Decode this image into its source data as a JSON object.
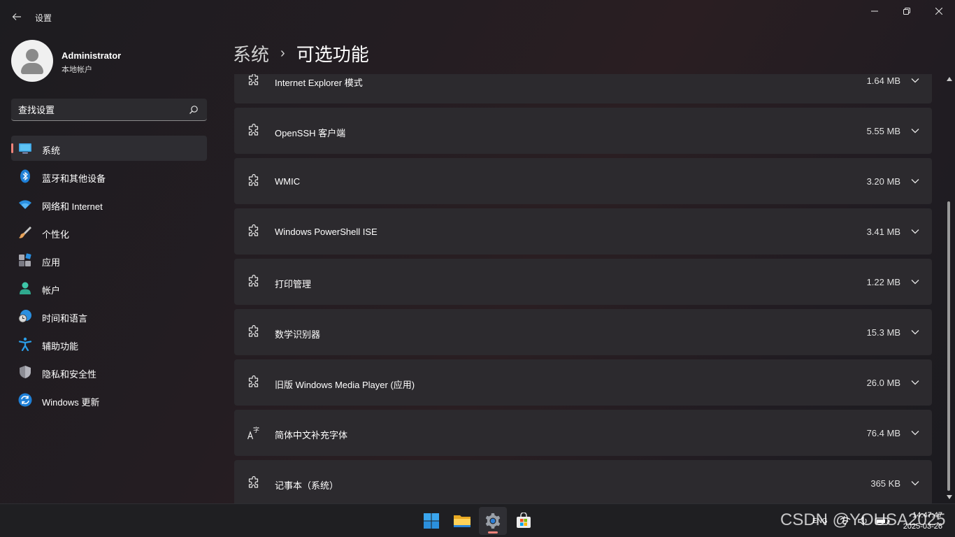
{
  "window": {
    "app_title": "设置",
    "back_icon": "back-arrow-icon",
    "minimize_icon": "minimize-icon",
    "maximize_icon": "restore-icon",
    "close_icon": "close-icon"
  },
  "profile": {
    "name": "Administrator",
    "account_type": "本地帐户"
  },
  "search": {
    "placeholder": "查找设置",
    "icon": "search-icon"
  },
  "sidebar": {
    "items": [
      {
        "label": "系统",
        "icon": "display-icon",
        "active": true
      },
      {
        "label": "蓝牙和其他设备",
        "icon": "bluetooth-icon",
        "active": false
      },
      {
        "label": "网络和 Internet",
        "icon": "wifi-icon",
        "active": false
      },
      {
        "label": "个性化",
        "icon": "paintbrush-icon",
        "active": false
      },
      {
        "label": "应用",
        "icon": "apps-icon",
        "active": false
      },
      {
        "label": "帐户",
        "icon": "person-icon",
        "active": false
      },
      {
        "label": "时间和语言",
        "icon": "globe-clock-icon",
        "active": false
      },
      {
        "label": "辅助功能",
        "icon": "accessibility-icon",
        "active": false
      },
      {
        "label": "隐私和安全性",
        "icon": "shield-icon",
        "active": false
      },
      {
        "label": "Windows 更新",
        "icon": "update-icon",
        "active": false
      }
    ]
  },
  "breadcrumb": {
    "parent": "系统",
    "separator": "›",
    "current": "可选功能"
  },
  "features": [
    {
      "name": "Internet Explorer 模式",
      "size": "1.64 MB",
      "icon": "puzzle-icon"
    },
    {
      "name": "OpenSSH 客户端",
      "size": "5.55 MB",
      "icon": "puzzle-icon"
    },
    {
      "name": "WMIC",
      "size": "3.20 MB",
      "icon": "puzzle-icon"
    },
    {
      "name": "Windows PowerShell ISE",
      "size": "3.41 MB",
      "icon": "puzzle-icon"
    },
    {
      "name": "打印管理",
      "size": "1.22 MB",
      "icon": "puzzle-icon"
    },
    {
      "name": "数学识别器",
      "size": "15.3 MB",
      "icon": "puzzle-icon"
    },
    {
      "name": "旧版 Windows Media Player (应用)",
      "size": "26.0 MB",
      "icon": "puzzle-icon"
    },
    {
      "name": "简体中文补充字体",
      "size": "76.4 MB",
      "icon": "font-icon"
    },
    {
      "name": "记事本（系统）",
      "size": "365 KB",
      "icon": "puzzle-icon"
    }
  ],
  "taskbar": {
    "apps": [
      "start-icon",
      "file-explorer-icon",
      "settings-icon",
      "store-icon"
    ],
    "active_app": "settings-icon",
    "language": "ENG",
    "time": "14:47:47",
    "date": "2025-03-26"
  },
  "watermark": "CSDN @YOUSA2025",
  "colors": {
    "accent": "#f0837a",
    "card": "#2c2a2e",
    "taskbar": "#1f1f22"
  }
}
